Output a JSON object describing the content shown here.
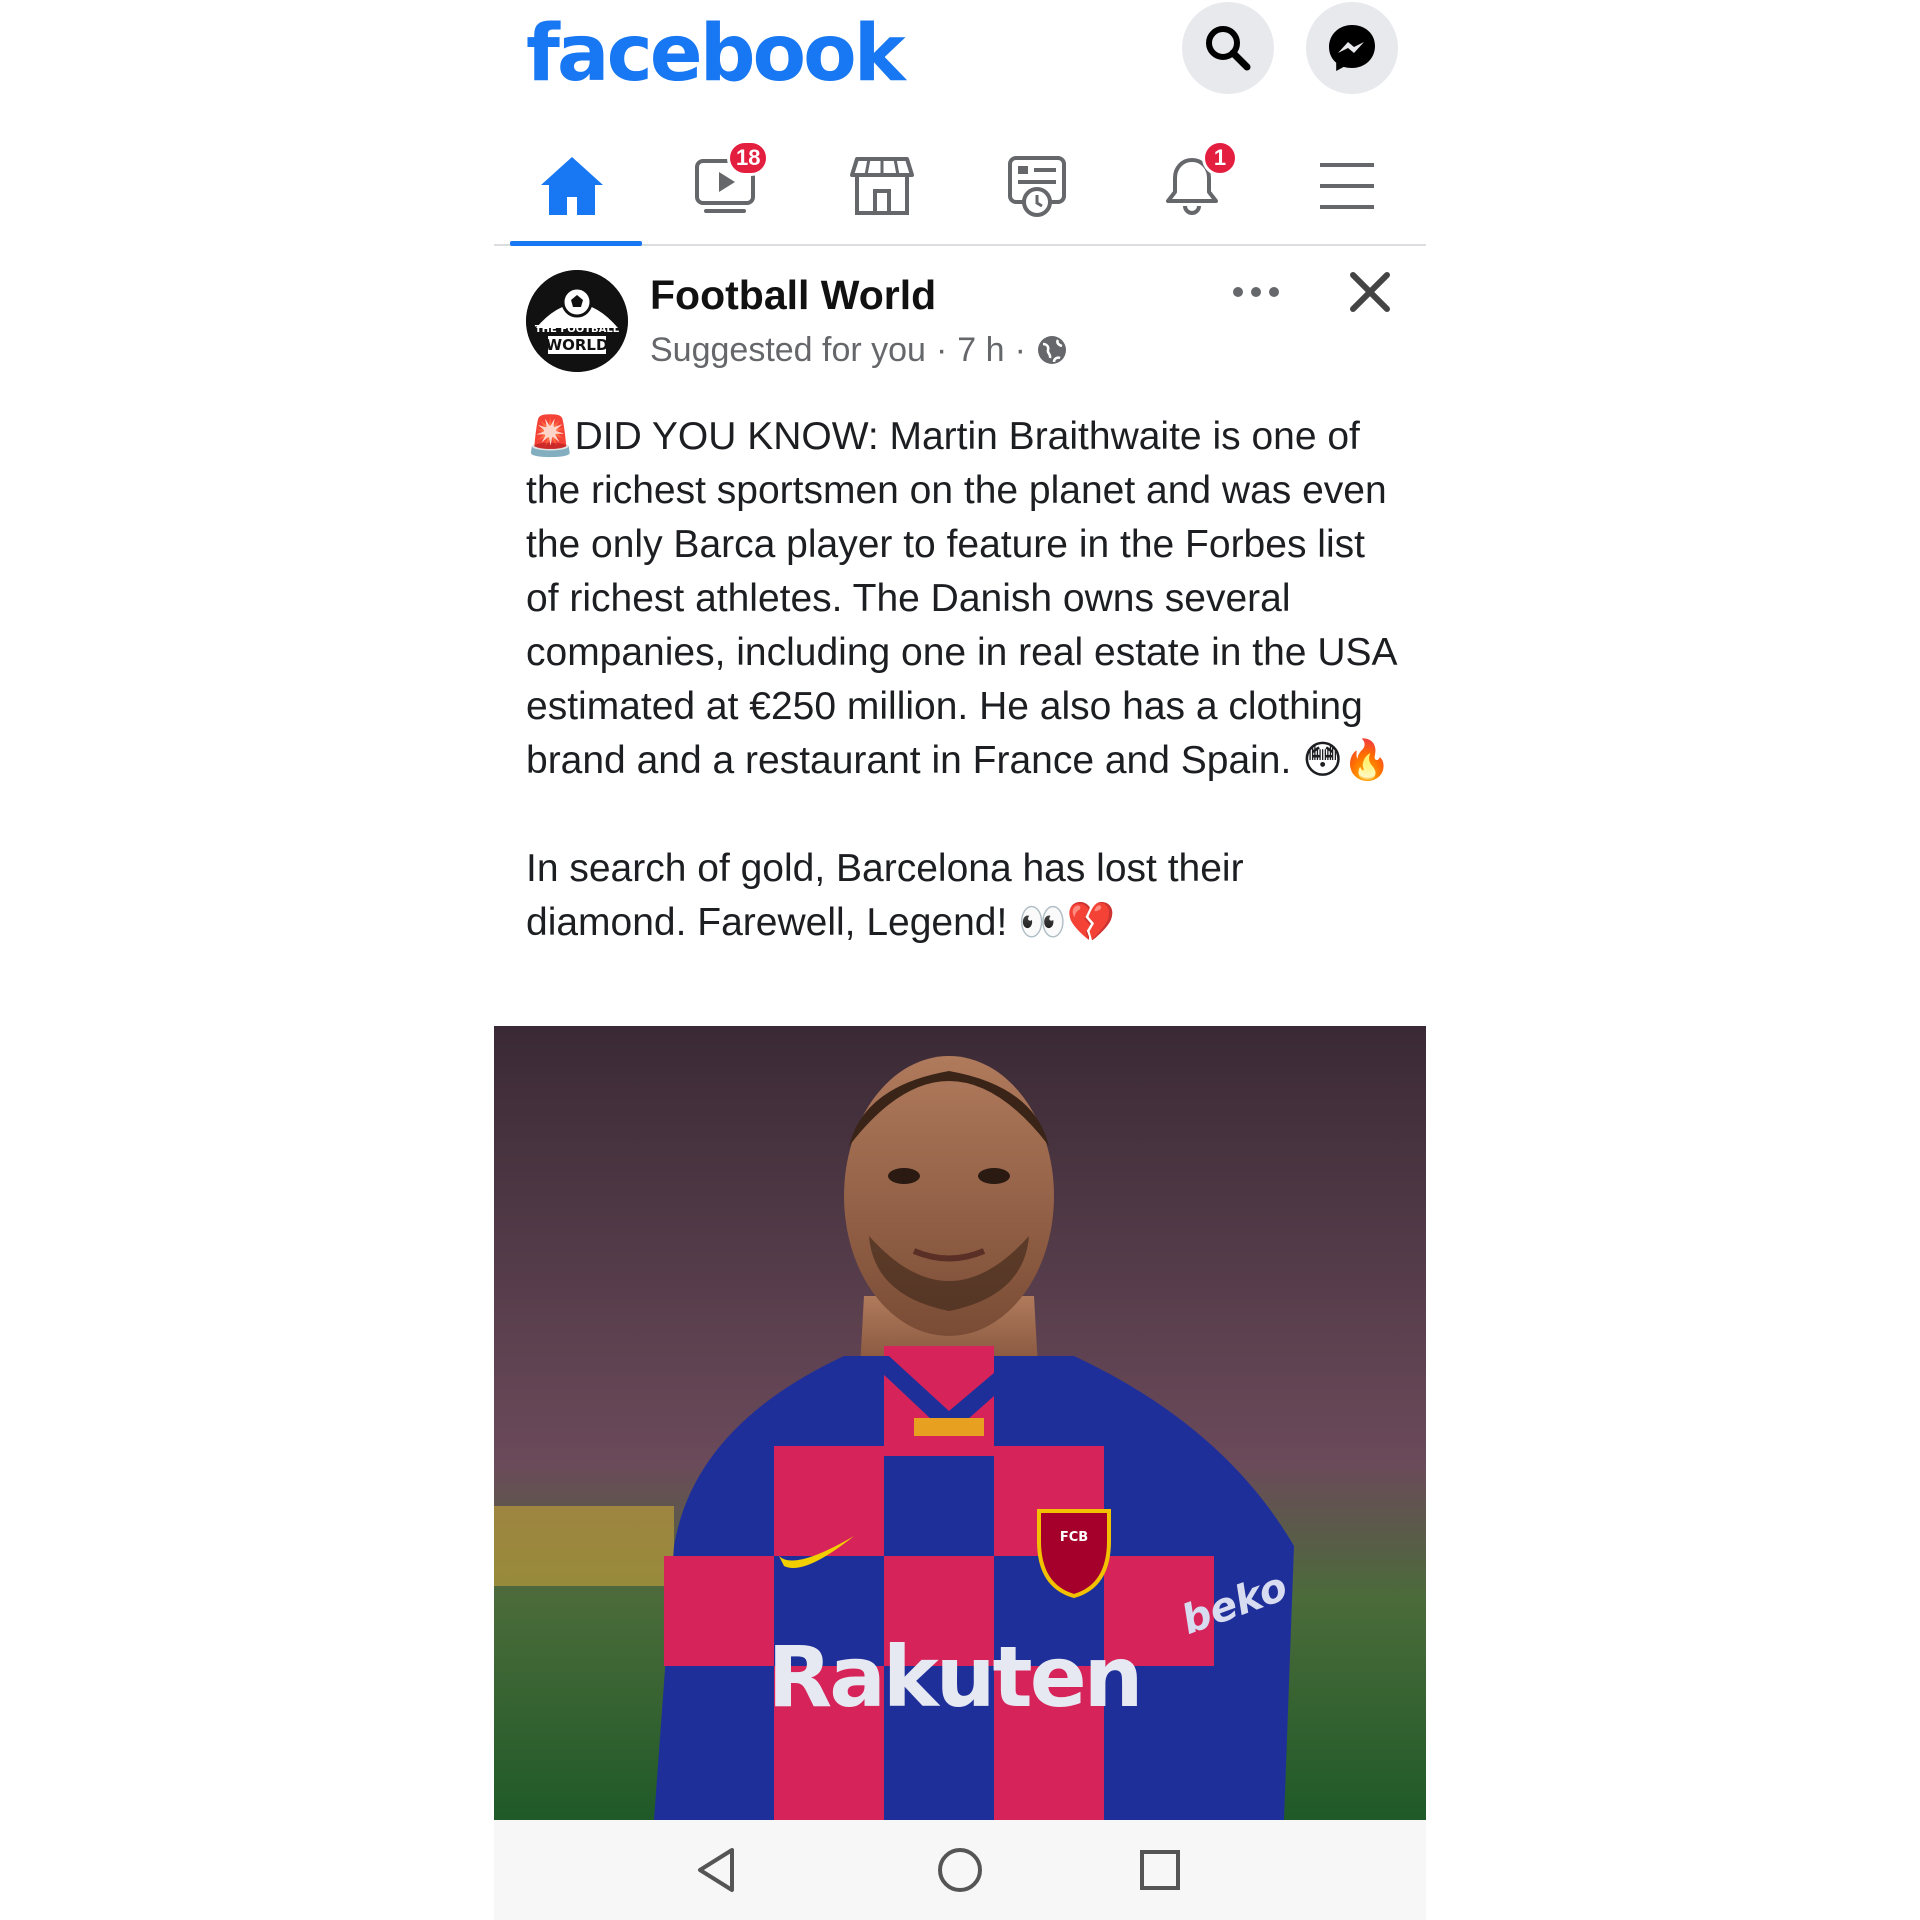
{
  "header": {
    "logo": "facebook"
  },
  "tabs": [
    {
      "name": "home",
      "icon": "home-icon",
      "active": true
    },
    {
      "name": "watch",
      "icon": "video-icon",
      "badge": "18"
    },
    {
      "name": "marketplace",
      "icon": "marketplace-icon"
    },
    {
      "name": "news",
      "icon": "news-icon"
    },
    {
      "name": "notifications",
      "icon": "bell-icon",
      "badge": "1"
    },
    {
      "name": "menu",
      "icon": "hamburger-icon"
    }
  ],
  "post": {
    "page_name": "Football World",
    "avatar_text_top": "THE FOOTBALL",
    "avatar_text_bottom": "WORLD",
    "meta_suggested": "Suggested for you",
    "meta_sep": "·",
    "meta_time": "7 h",
    "paragraph1_emoji": "🚨",
    "paragraph1": "DID YOU KNOW: Martin Braithwaite is one of the richest sportsmen on the planet and was even the only Barca player to feature in the Forbes list of richest athletes. The Danish owns several companies, including one in real estate in the USA estimated at €250 million. He also has a clothing brand and a restaurant in France and Spain.",
    "paragraph1_end_emoji": "😳🔥",
    "paragraph2": "In search of gold, Barcelona has lost their diamond. Farewell, Legend!",
    "paragraph2_end_emoji": "👀💔",
    "image": {
      "description_icon": "player-photo",
      "shirt_sponsor": "Rakuten",
      "sleeve_sponsor": "beko",
      "crest": "FCB"
    }
  },
  "colors": {
    "brand": "#1877f2",
    "badge": "#e41e3f",
    "text": "#1c1e21",
    "meta": "#65676b"
  }
}
